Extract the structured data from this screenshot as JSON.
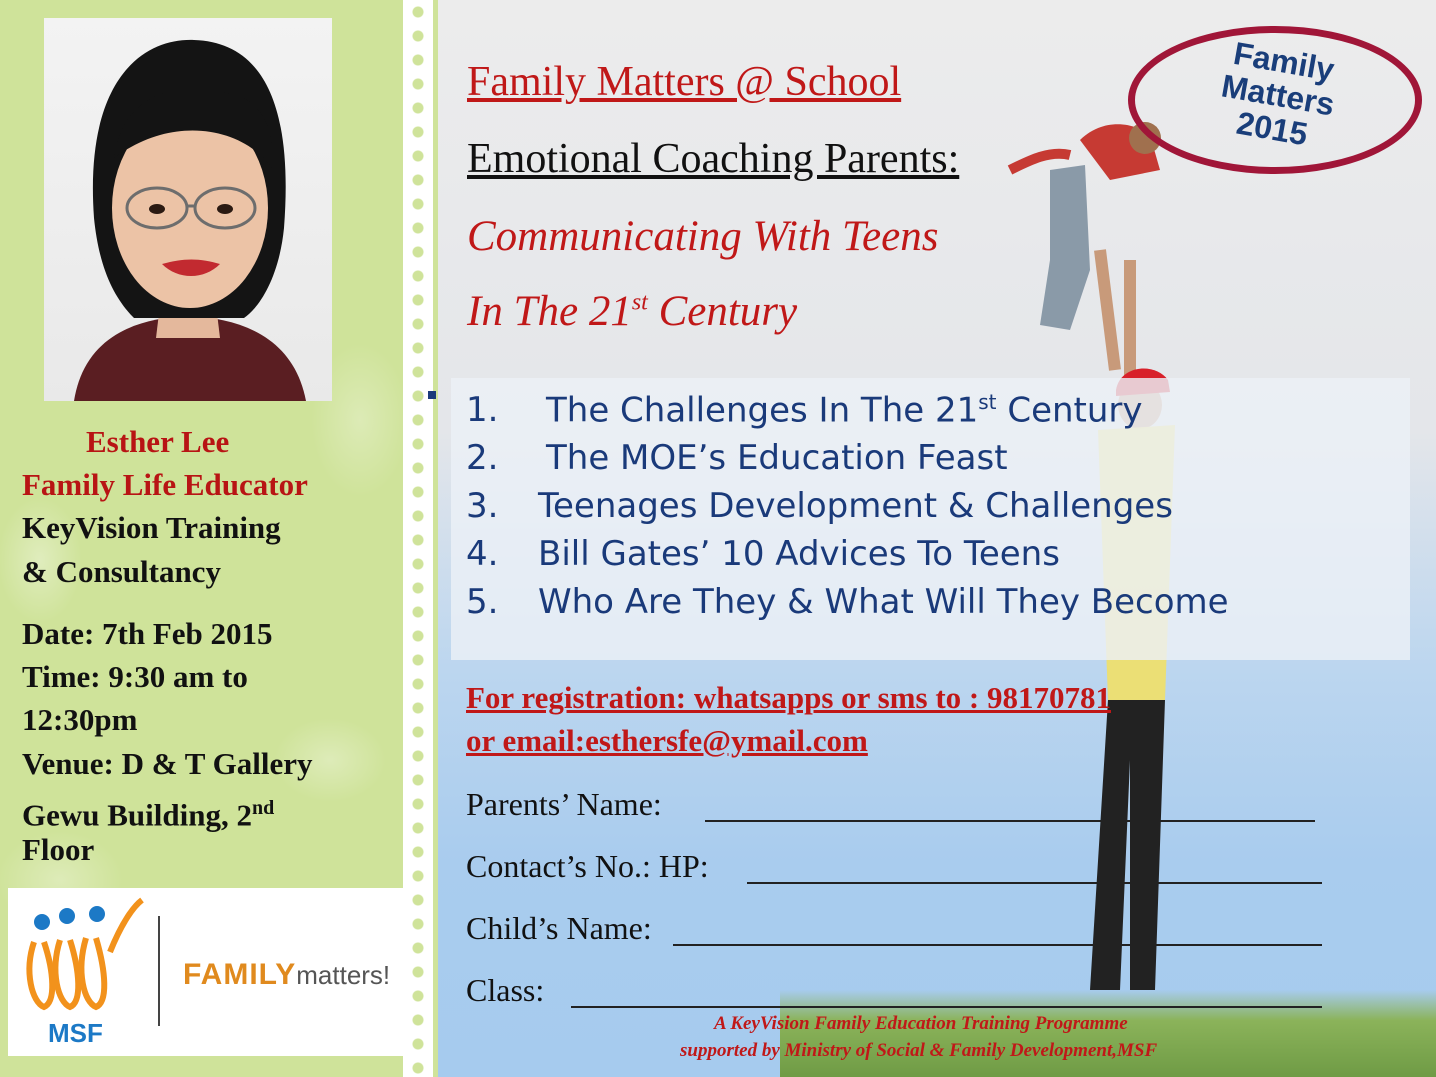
{
  "speaker": {
    "name": "Esther Lee",
    "role": "Family Life Educator",
    "org_line1": "KeyVision Training",
    "org_line2": "& Consultancy"
  },
  "event": {
    "date": "Date: 7th Feb 2015",
    "time_line1": "Time: 9:30 am to",
    "time_line2": "12:30pm",
    "venue_line1": "Venue: D & T Gallery",
    "venue_line2_a": "Gewu Building, 2",
    "venue_line2_sup": "nd",
    "venue_line3": "Floor"
  },
  "logos": {
    "msf_label": "MSF",
    "family_label": "FAMILY",
    "matters_label": "matters!"
  },
  "titles": {
    "line1": "Family Matters @ School",
    "line2": "Emotional Coaching Parents:",
    "line3": "Communicating With Teens",
    "line4_a": "In The 21",
    "line4_sup": "st",
    "line4_b": " Century"
  },
  "badge": {
    "line1": "Family",
    "line2": "Matters",
    "line3": "2015"
  },
  "agenda": [
    {
      "num": "1.",
      "text_a": "The Challenges In The 21",
      "sup": "st",
      "text_b": " Century"
    },
    {
      "num": "2.",
      "text_a": "The MOE’s Education Feast",
      "sup": "",
      "text_b": ""
    },
    {
      "num": "3.",
      "text_a": "Teenages Development & Challenges",
      "sup": "",
      "text_b": ""
    },
    {
      "num": "4.",
      "text_a": "Bill Gates’ 10 Advices To Teens",
      "sup": "",
      "text_b": ""
    },
    {
      "num": "5.",
      "text_a": "Who Are They & What Will They Become",
      "sup": "",
      "text_b": ""
    }
  ],
  "registration": {
    "line1": "For registration: whatsapps or sms to :        98170781",
    "line2": "or email:esthersfe@ymail.com"
  },
  "form": {
    "parents_name": "Parents’ Name:",
    "contact": "Contact’s No.: HP:",
    "child_name": "Child’s Name:",
    "class": "Class:"
  },
  "footer": {
    "line1": "A KeyVision Family Education Training Programme",
    "line2": "supported by Ministry of  Social & Family Development,MSF"
  },
  "colors": {
    "accent_red": "#c01818",
    "navy": "#1a3a7a",
    "green_panel": "#cfe39a",
    "badge_border": "#a01638"
  }
}
